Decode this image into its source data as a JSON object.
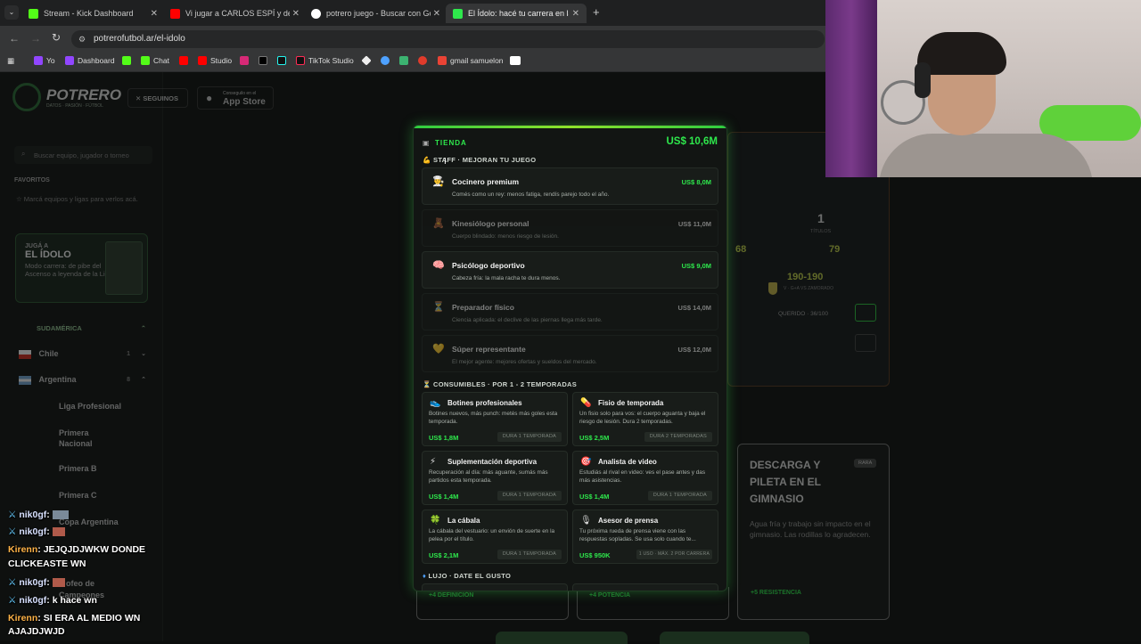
{
  "browser": {
    "tabs": [
      {
        "title": "Stream - Kick Dashboard"
      },
      {
        "title": "Vi jugar a CARLOS ESPÍ y descu"
      },
      {
        "title": "potrero juego - Buscar con Goo"
      },
      {
        "title": "El Ídolo: hacé tu carrera en la L"
      }
    ],
    "new_tab": "+",
    "url": "potrerofutbol.ar/el-idolo",
    "bookmarks": [
      "Yo",
      "Dashboard",
      "Chat",
      "Studio",
      "TikTok Studio",
      "gmail samuelon"
    ]
  },
  "site": {
    "logo": "POTRERO",
    "logo_sub": "DATOS · PASIÓN · FÚTBOL",
    "follow_label": "SEGUINOS",
    "appstore_small": "Conseguilo en el",
    "appstore_big": "App Store",
    "search_placeholder": "Buscar equipo, jugador o torneo",
    "favorites_title": "FAVORITOS",
    "favorites_hint": "☆ Marcá equipos y ligas para verlos acá.",
    "promo": {
      "line1": "JUGÁ A",
      "line2": "EL ÍDOLO",
      "desc": "Modo carrera: de pibe del Ascenso a leyenda de la Liga"
    },
    "region": "SUDAMÉRICA",
    "countries": [
      {
        "name": "Chile",
        "count": "1"
      },
      {
        "name": "Argentina",
        "count": "8"
      }
    ],
    "leagues": [
      "Liga Profesional",
      "Primera Nacional",
      "Primera B",
      "Primera C",
      "Copa Argentina"
    ],
    "partial_trofeo": "ofeo de",
    "partial_campeones": "Campeones"
  },
  "background_card": {
    "titles_value": "1",
    "titles_label": "TÍTULOS",
    "stat1": "68",
    "stat2": "79",
    "record": "190-190",
    "record_sub": "V · G+A VS ZAMORADO",
    "querido": "QUERIDO · 36/100",
    "event_title": "DESCARGA Y PILETA EN EL GIMNASIO",
    "event_tag": "RARA",
    "event_desc": "Agua fría y trabajo sin impacto en el gimnasio. Las rodillas lo agradecen.",
    "bottom1": "+4 DEFINICIÓN",
    "bottom2": "+4 POTENCIA",
    "bottom3": "+5 RESISTENCIA"
  },
  "shop": {
    "title": "TIENDA",
    "balance": "US$ 10,6M",
    "staff_label": "STAFF · MEJORAN TU JUEGO",
    "staff": [
      {
        "icon": "👨‍🍳",
        "name": "Cocinero premium",
        "desc": "Comés como un rey: menos fatiga, rendís parejo todo el año.",
        "price": "US$ 8,0M",
        "affordable": true
      },
      {
        "icon": "🧸",
        "name": "Kinesiólogo personal",
        "desc": "Cuerpo blindado: menos riesgo de lesión.",
        "price": "US$ 11,0M",
        "affordable": false
      },
      {
        "icon": "🧠",
        "name": "Psicólogo deportivo",
        "desc": "Cabeza fría: la mala racha te dura menos.",
        "price": "US$ 9,0M",
        "affordable": true
      },
      {
        "icon": "⏳",
        "name": "Preparador físico",
        "desc": "Ciencia aplicada: el declive de las piernas llega más tarde.",
        "price": "US$ 14,0M",
        "affordable": false
      },
      {
        "icon": "💛",
        "name": "Súper representante",
        "desc": "El mejor agente: mejores ofertas y sueldos del mercado.",
        "price": "US$ 12,0M",
        "affordable": false
      }
    ],
    "consumables_label": "CONSUMIBLES · POR 1 - 2 TEMPORADAS",
    "consumables": [
      {
        "icon": "👟",
        "name": "Botines profesionales",
        "desc": "Botines nuevos, más punch: metés más goles esta temporada.",
        "price": "US$ 1,8M",
        "tag": "DURA 1 TEMPORADA"
      },
      {
        "icon": "💊",
        "name": "Fisio de temporada",
        "desc": "Un fisio solo para vos: el cuerpo aguanta y baja el riesgo de lesión. Dura 2 temporadas.",
        "price": "US$ 2,5M",
        "tag": "DURA 2 TEMPORADAS"
      },
      {
        "icon": "⚡",
        "name": "Suplementación deportiva",
        "desc": "Recuperación al día: más aguante, sumás más partidos esta temporada.",
        "price": "US$ 1,4M",
        "tag": "DURA 1 TEMPORADA"
      },
      {
        "icon": "🎯",
        "name": "Analista de video",
        "desc": "Estudiás al rival en video: ves el pase antes y das más asistencias.",
        "price": "US$ 1,4M",
        "tag": "DURA 1 TEMPORADA"
      },
      {
        "icon": "🍀",
        "name": "La cábala",
        "desc": "La cábala del vestuario: un envión de suerte en la pelea por el título.",
        "price": "US$ 2,1M",
        "tag": "DURA 1 TEMPORADA"
      },
      {
        "icon": "🎙",
        "name": "Asesor de prensa",
        "desc": "Tu próxima rueda de prensa viene con las respuestas sopladas. Se usa solo cuando te...",
        "price": "US$ 950K",
        "tag": "1 USO · MÁX. 2 POR CARRERA"
      }
    ],
    "lujo_label": "LUJO · DATE EL GUSTO"
  },
  "chat": [
    {
      "user": "nik0gf",
      "msg": ""
    },
    {
      "user": "nik0gf",
      "msg": ""
    },
    {
      "user": "Kirenn",
      "msg": "JEJQJDJWKW DONDE"
    },
    {
      "user": "",
      "msg": "CLICKEASTE WN"
    },
    {
      "user": "nik0gf",
      "msg": ""
    },
    {
      "user": "nik0gf",
      "msg": "k hace wn"
    },
    {
      "user": "Kirenn",
      "msg": "SI ERA AL MEDIO WN"
    },
    {
      "user": "",
      "msg": "AJAJDJWJD"
    }
  ],
  "colors": {
    "accent": "#2ee84c",
    "panel": "#121513",
    "chrome": "#353637"
  }
}
